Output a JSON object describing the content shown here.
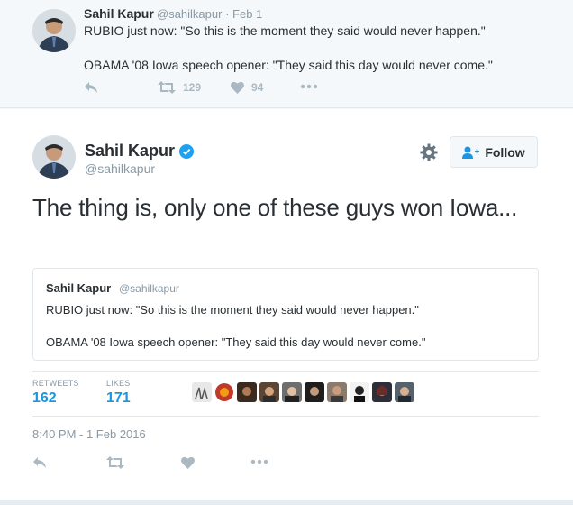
{
  "context_tweet": {
    "name": "Sahil Kapur",
    "handle": "@sahilkapur",
    "date": "· Feb 1",
    "line1": "RUBIO just now: \"So this is the moment they said would never happen.\"",
    "line2": "OBAMA '08 Iowa speech opener: \"They said this day would never come.\"",
    "retweet_count": "129",
    "like_count": "94"
  },
  "main_tweet": {
    "name": "Sahil Kapur",
    "handle": "@sahilkapur",
    "follow_label": "Follow",
    "text": "The thing is, only one of these guys won Iowa...",
    "quoted": {
      "name": "Sahil Kapur",
      "handle": "@sahilkapur",
      "line1": "RUBIO just now: \"So this is the moment they said would never happen.\"",
      "line2": "OBAMA '08 Iowa speech opener: \"They said this day would never come.\""
    },
    "stats": {
      "retweets_label": "RETWEETS",
      "retweets_value": "162",
      "likes_label": "LIKES",
      "likes_value": "171"
    },
    "timestamp": "8:40 PM - 1 Feb 2016"
  },
  "colors": {
    "accent": "#1b95e0",
    "muted": "#8899a6",
    "icon": "#aab8c2",
    "text": "#292f33"
  },
  "icons": [
    "reply-icon",
    "retweet-icon",
    "heart-icon",
    "more-icon",
    "gear-icon",
    "follow-person-icon",
    "verified-icon"
  ]
}
